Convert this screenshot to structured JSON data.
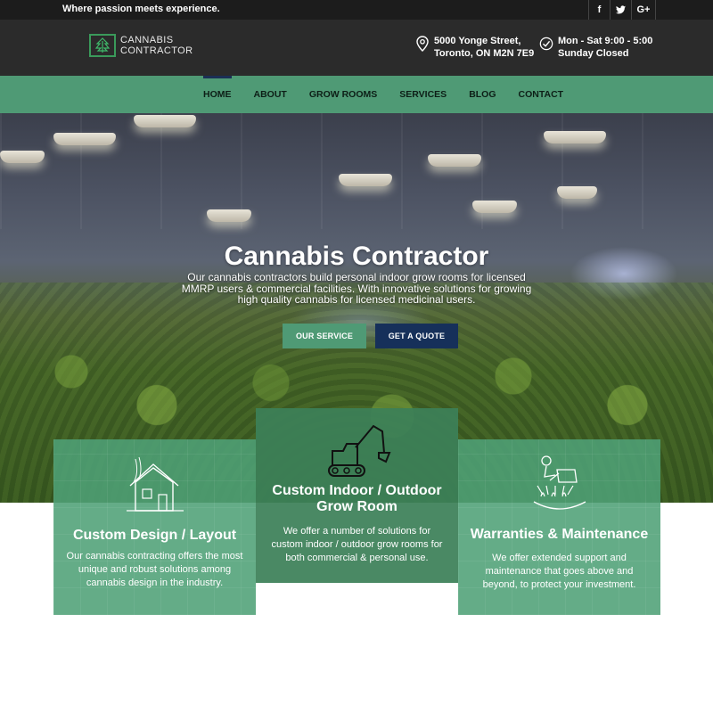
{
  "topbar": {
    "tagline": "Where passion meets experience.",
    "social": [
      {
        "icon": "facebook-icon",
        "glyph": "f"
      },
      {
        "icon": "twitter-icon",
        "glyph": "t"
      },
      {
        "icon": "google-plus-icon",
        "glyph": "G+"
      }
    ]
  },
  "header": {
    "logo": {
      "line1": "CANNABIS",
      "line2": "CONTRACTOR"
    },
    "address": {
      "icon": "location-pin-icon",
      "line1": "5000 Yonge Street,",
      "line2": "Toronto, ON M2N 7E9"
    },
    "hours": {
      "icon": "check-circle-icon",
      "line1": "Mon - Sat 9:00 - 5:00",
      "line2": "Sunday Closed"
    }
  },
  "nav": {
    "items": [
      {
        "label": "HOME",
        "active": true
      },
      {
        "label": "ABOUT",
        "active": false
      },
      {
        "label": "GROW ROOMS",
        "active": false
      },
      {
        "label": "SERVICES",
        "active": false
      },
      {
        "label": "BLOG",
        "active": false
      },
      {
        "label": "CONTACT",
        "active": false
      }
    ]
  },
  "hero": {
    "title": "Cannabis Contractor",
    "subtitle": "Our cannabis contractors build personal indoor grow rooms for licensed MMRP users & commercial facilities. With innovative solutions for growing high quality cannabis for licensed medicinal users.",
    "service_button": "OUR SERVICE",
    "quote_button": "GET A QUOTE"
  },
  "features": [
    {
      "icon": "house-sketch-icon",
      "title": "Custom Design / Layout",
      "text": "Our cannabis contracting offers the most unique and robust solutions among cannabis design in the industry."
    },
    {
      "icon": "excavator-icon",
      "title": "Custom Indoor / Outdoor Grow Room",
      "text": "We offer a number of solutions for custom indoor / outdoor grow rooms for both commercial & personal use."
    },
    {
      "icon": "watering-can-icon",
      "title": "Warranties & Maintenance",
      "text": "We offer extended support and maintenance that goes above and beyond, to protect your investment."
    }
  ],
  "colors": {
    "topbar": "#1c1c1c",
    "header": "#2b2b2b",
    "nav_green": "#4f9a75",
    "nav_active_indicator": "#1b2f55",
    "quote_button": "#16305a",
    "feature_green": "#4fa076",
    "feature_green_dark": "#3c8058"
  }
}
